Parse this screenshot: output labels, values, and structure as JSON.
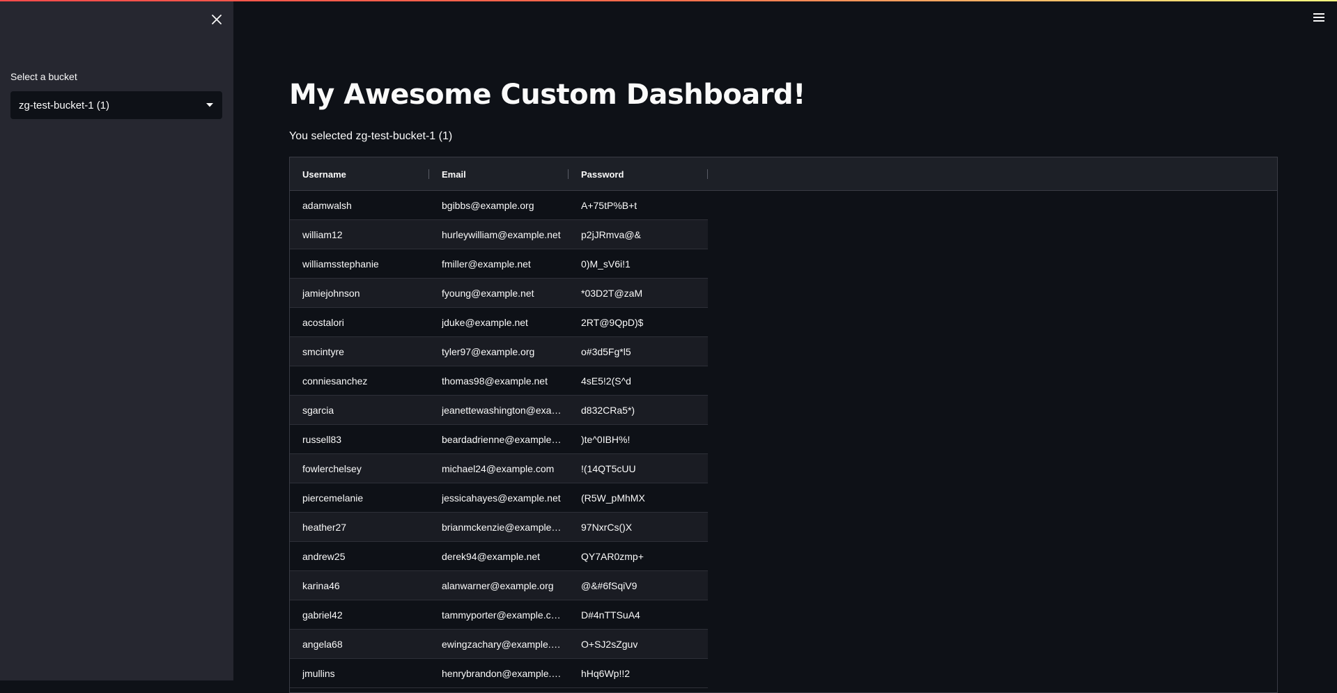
{
  "sidebar": {
    "select_label": "Select a bucket",
    "select_value": "zg-test-bucket-1 (1)"
  },
  "main": {
    "title": "My Awesome Custom Dashboard!",
    "selection_text": "You selected zg-test-bucket-1 (1)"
  },
  "table": {
    "columns": [
      "Username",
      "Email",
      "Password"
    ],
    "rows": [
      [
        "adamwalsh",
        "bgibbs@example.org",
        "A+75tP%B+t"
      ],
      [
        "william12",
        "hurleywilliam@example.net",
        "p2jJRmva@&"
      ],
      [
        "williamsstephanie",
        "fmiller@example.net",
        "0)M_sV6i!1"
      ],
      [
        "jamiejohnson",
        "fyoung@example.net",
        "*03D2T@zaM"
      ],
      [
        "acostalori",
        "jduke@example.net",
        "2RT@9QpD)$"
      ],
      [
        "smcintyre",
        "tyler97@example.org",
        "o#3d5Fg*l5"
      ],
      [
        "conniesanchez",
        "thomas98@example.net",
        "4sE5!2(S^d"
      ],
      [
        "sgarcia",
        "jeanettewashington@example.com",
        "d832CRa5*)"
      ],
      [
        "russell83",
        "beardadrienne@example.com",
        ")te^0IBH%!"
      ],
      [
        "fowlerchelsey",
        "michael24@example.com",
        "!(14QT5cUU"
      ],
      [
        "piercemelanie",
        "jessicahayes@example.net",
        "(R5W_pMhMX"
      ],
      [
        "heather27",
        "brianmckenzie@example.com",
        "97NxrCs()X"
      ],
      [
        "andrew25",
        "derek94@example.net",
        "QY7AR0zmp+"
      ],
      [
        "karina46",
        "alanwarner@example.org",
        "@&#6fSqiV9"
      ],
      [
        "gabriel42",
        "tammyporter@example.com",
        "D#4nTTSuA4"
      ],
      [
        "angela68",
        "ewingzachary@example.com",
        "O+SJ2sZguv"
      ],
      [
        "jmullins",
        "henrybrandon@example.com",
        "hHq6Wp!!2"
      ]
    ]
  },
  "icons": {
    "close": "close-icon",
    "menu": "hamburger-menu-icon",
    "dropdown": "caret-down-icon"
  },
  "colors": {
    "background": "#0e1117",
    "sidebar": "#262730",
    "accent_gradient_start": "#ff4b4b",
    "accent_gradient_end": "#fffd80"
  }
}
